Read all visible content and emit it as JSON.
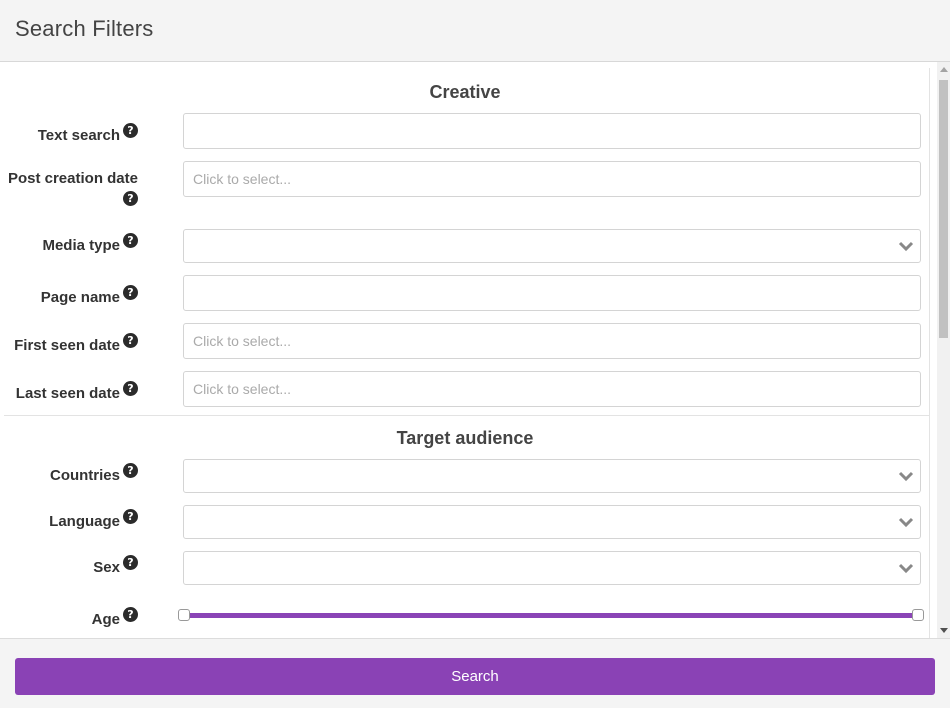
{
  "header": {
    "title": "Search Filters"
  },
  "sections": {
    "creative": {
      "title": "Creative",
      "fields": {
        "text_search": {
          "label": "Text search",
          "value": "",
          "placeholder": ""
        },
        "post_creation_date": {
          "label": "Post creation date",
          "placeholder": "Click to select..."
        },
        "media_type": {
          "label": "Media type",
          "value": ""
        },
        "page_name": {
          "label": "Page name",
          "value": "",
          "placeholder": ""
        },
        "first_seen_date": {
          "label": "First seen date",
          "placeholder": "Click to select..."
        },
        "last_seen_date": {
          "label": "Last seen date",
          "placeholder": "Click to select..."
        }
      }
    },
    "target_audience": {
      "title": "Target audience",
      "fields": {
        "countries": {
          "label": "Countries",
          "value": ""
        },
        "language": {
          "label": "Language",
          "value": ""
        },
        "sex": {
          "label": "Sex",
          "value": ""
        },
        "age": {
          "label": "Age",
          "range_fraction": [
            0,
            1
          ]
        }
      }
    }
  },
  "help_glyph": "?",
  "icons": {
    "help": "question-circle-icon",
    "dropdown": "chevron-down-icon"
  },
  "colors": {
    "accent": "#8a42b5",
    "header_bg": "#f4f4f4"
  },
  "footer": {
    "search_label": "Search"
  }
}
